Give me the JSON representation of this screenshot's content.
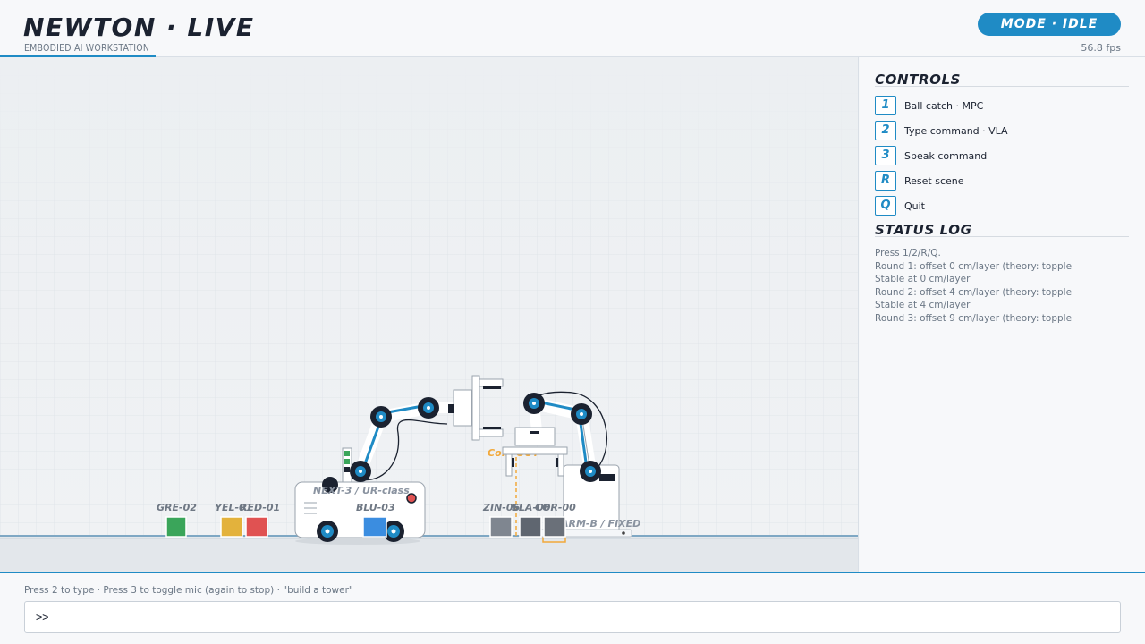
{
  "header": {
    "title": "NEWTON · LIVE",
    "subtitle": "EMBODIED AI WORKSTATION",
    "mode": "MODE · IDLE",
    "fps": "56.8 fps"
  },
  "scene": {
    "blocks": [
      {
        "label": "GRE-02",
        "color": "#3aa55a"
      },
      {
        "label": "YEL-01",
        "color": "#e3b23c"
      },
      {
        "label": "RED-01",
        "color": "#e05252"
      },
      {
        "label": "BLU-03",
        "color": "#3b8de0"
      },
      {
        "label": "ZIN-06",
        "color": "#7f8690"
      },
      {
        "label": "SLA-06",
        "color": "#5f6670"
      },
      {
        "label": "COR-00",
        "color": "#6a7079"
      }
    ],
    "mobile_robot_label": "NEXT-3 / UR-class",
    "fixed_robot_label": "ARM-B / FIXED",
    "zone_label": "Co... OUT",
    "accent_color": "#1f8bc5",
    "zone_color": "#f2a93b"
  },
  "controls": {
    "heading": "CONTROLS",
    "items": [
      {
        "key": "1",
        "label": "Ball catch · MPC"
      },
      {
        "key": "2",
        "label": "Type command · VLA"
      },
      {
        "key": "3",
        "label": "Speak command"
      },
      {
        "key": "R",
        "label": "Reset scene"
      },
      {
        "key": "Q",
        "label": "Quit"
      }
    ]
  },
  "status_log": {
    "heading": "STATUS LOG",
    "lines": [
      "Press 1/2/R/Q.",
      "Round 1: offset 0 cm/layer (theory: topple",
      "Stable at 0 cm/layer",
      "Round 2: offset 4 cm/layer (theory: topple",
      "Stable at 4 cm/layer",
      "Round 3: offset 9 cm/layer (theory: topple"
    ]
  },
  "footer": {
    "hint": "Press 2 to type  ·  Press 3 to toggle mic (again to stop)  ·  \"build a tower\"",
    "prompt": ">>",
    "input_value": ""
  }
}
